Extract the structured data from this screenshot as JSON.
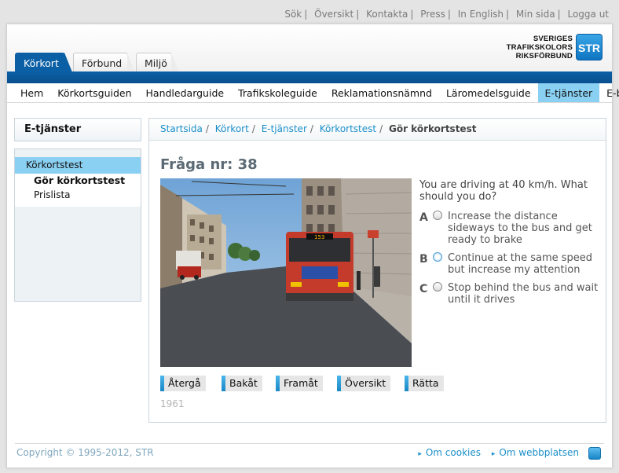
{
  "toplinks": [
    "Sök",
    "Översikt",
    "Kontakta",
    "Press",
    "In English",
    "Min sida",
    "Logga ut"
  ],
  "tabs": [
    "Körkort",
    "Förbund",
    "Miljö"
  ],
  "logo": {
    "line1": "SVERIGES",
    "line2": "TRAFIKSKOLORS",
    "line3": "RIKSFÖRBUND",
    "mark": "STR"
  },
  "nav": [
    "Hem",
    "Körkortsguiden",
    "Handledarguide",
    "Trafikskoleguide",
    "Reklamationsnämnd",
    "Läromedelsguide",
    "E-tjänster",
    "E-butik"
  ],
  "sidebar": {
    "title": "E-tjänster",
    "items": [
      "Körkortstest",
      "Gör körkortstest",
      "Prislista"
    ]
  },
  "breadcrumb": {
    "items": [
      "Startsida",
      "Körkort",
      "E-tjänster",
      "Körkortstest"
    ],
    "current": "Gör körkortstest"
  },
  "question": {
    "title": "Fråga nr: 38",
    "text": "You are driving at 40 km/h. What should you do?",
    "answers": [
      {
        "letter": "A",
        "text": "Increase the distance sideways to the bus and get ready to brake"
      },
      {
        "letter": "B",
        "text": "Continue at the same speed but increase my attention"
      },
      {
        "letter": "C",
        "text": "Stop behind the bus and wait until it drives"
      }
    ],
    "buttons": [
      "Återgå",
      "Bakåt",
      "Framåt",
      "Översikt",
      "Rätta"
    ],
    "id": "1961",
    "photo": {
      "bus_sign": "153"
    }
  },
  "footer": {
    "copyright": "Copyright © 1995-2012, STR",
    "links": [
      "Om cookies",
      "Om webbplatsen"
    ],
    "icon": "str-icon"
  },
  "colors": {
    "brand_blue": "#0b5fa5",
    "nav_active": "#8ad0f2",
    "link": "#1b8fc9"
  }
}
